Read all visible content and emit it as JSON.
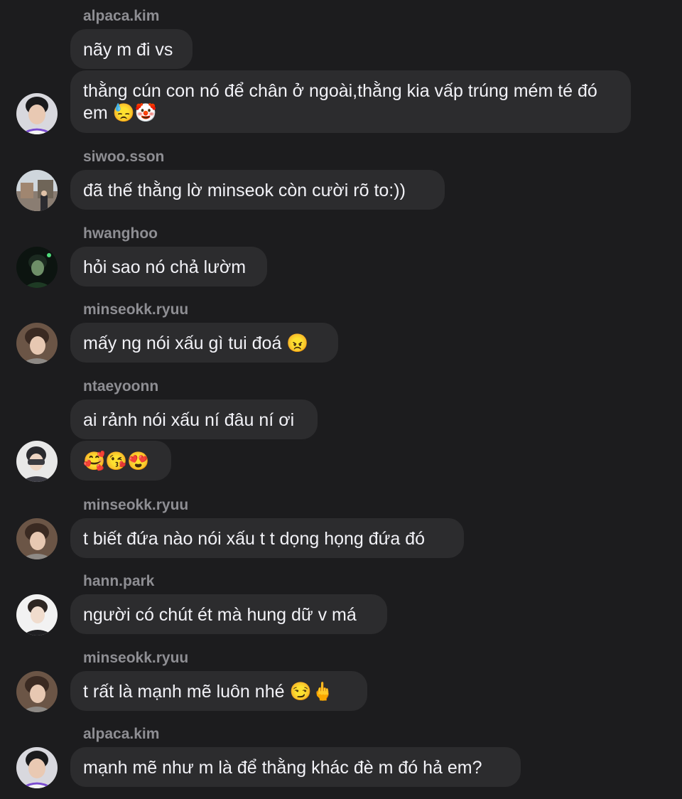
{
  "messages": [
    {
      "sender": "alpaca.kim",
      "bubbles": [
        "nãy m đi vs",
        "thằng cún con nó để chân ở ngoài,thằng kia vấp trúng mém té đó em 😓🤡"
      ]
    },
    {
      "sender": "siwoo.sson",
      "bubbles": [
        "đã thế thằng lờ minseok còn cười rõ to:))"
      ]
    },
    {
      "sender": "hwanghoo",
      "bubbles": [
        "hỏi sao nó chả lườm"
      ]
    },
    {
      "sender": "minseokk.ryuu",
      "bubbles": [
        "mấy ng nói xấu gì tui đoá 😠"
      ]
    },
    {
      "sender": "ntaeyoonn",
      "bubbles": [
        "ai rảnh nói xấu ní đâu ní ơi",
        "🥰😘😍"
      ]
    },
    {
      "sender": "minseokk.ryuu",
      "bubbles": [
        "t biết đứa nào nói xấu t t dọng họng đứa đó"
      ]
    },
    {
      "sender": "hann.park",
      "bubbles": [
        "người có chút ét mà hung dữ v má"
      ]
    },
    {
      "sender": "minseokk.ryuu",
      "bubbles": [
        "t rất là mạnh mẽ luôn nhé 😏🖕"
      ]
    },
    {
      "sender": "alpaca.kim",
      "bubbles": [
        "mạnh mẽ như m là để thằng khác đè m đó hả em?"
      ]
    }
  ]
}
